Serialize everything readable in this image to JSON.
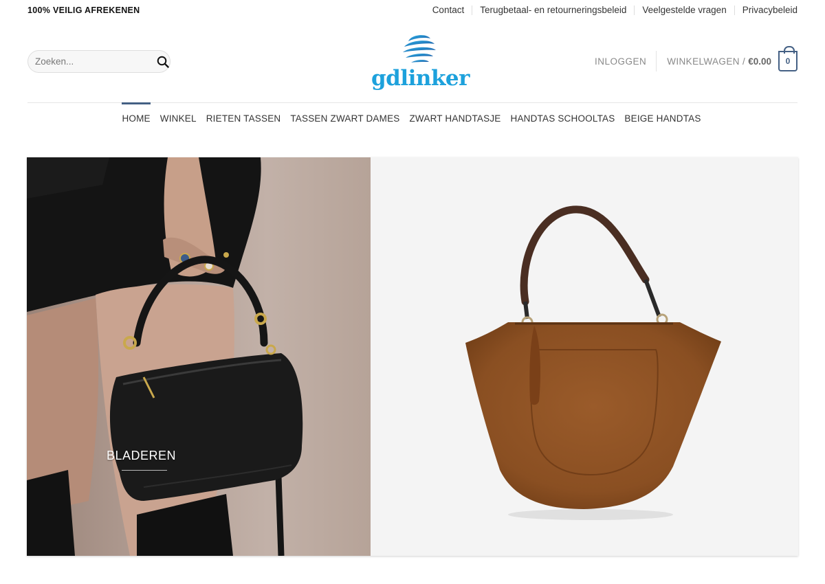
{
  "topbar": {
    "secure_text": "100% VEILIG AFREKENEN",
    "links": [
      "Contact",
      "Terugbetaal- en retourneringsbeleid",
      "Veelgestelde vragen",
      "Privacybeleid"
    ]
  },
  "header": {
    "search_placeholder": "Zoeken...",
    "logo_text": "gdlinker",
    "login_label": "INLOGGEN",
    "cart_label": "WINKELWAGEN /",
    "cart_amount": "€0.00",
    "cart_count": "0"
  },
  "nav": {
    "items": [
      "HOME",
      "WINKEL",
      "RIETEN TASSEN",
      "TASSEN ZWART DAMES",
      "ZWART HANDTASJE",
      "HANDTAS SCHOOLTAS",
      "BEIGE HANDTAS"
    ],
    "active": "HOME"
  },
  "banner": {
    "cta_label": "BLADEREN"
  },
  "colors": {
    "accent": "#446084",
    "logo_blue": "#1da1dc",
    "logo_dark_blue": "#1b4f9c",
    "text": "#333333",
    "muted": "#888888"
  },
  "icons": {
    "search": "search-icon",
    "cart": "cart-icon",
    "logo": "globe-swirl-logo-icon"
  }
}
